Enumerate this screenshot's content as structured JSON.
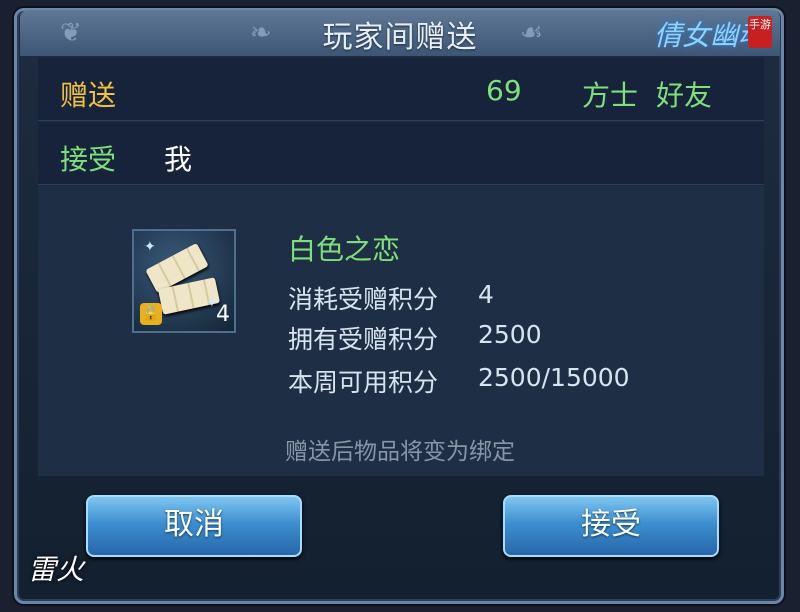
{
  "title": "玩家间赠送",
  "logo": {
    "text": "倩女幽魂",
    "tag": "手游"
  },
  "give_row": {
    "label": "赠送",
    "level": "69",
    "class": "方士",
    "relation": "好友"
  },
  "receive_row": {
    "label": "接受",
    "target": "我"
  },
  "item": {
    "name": "白色之恋",
    "count": "4",
    "icon": "white-chocolate-icon",
    "locked": true
  },
  "stats": [
    {
      "label": "消耗受赠积分",
      "value": "4"
    },
    {
      "label": "拥有受赠积分",
      "value": "2500"
    },
    {
      "label": "本周可用积分",
      "value": "2500/15000"
    }
  ],
  "note": "赠送后物品将变为绑定",
  "buttons": {
    "cancel": "取消",
    "accept": "接受"
  },
  "watermark": "雷火",
  "colors": {
    "gold": "#f0c040",
    "green": "#7fe07a",
    "accent_blue": "#3d8fd0"
  }
}
